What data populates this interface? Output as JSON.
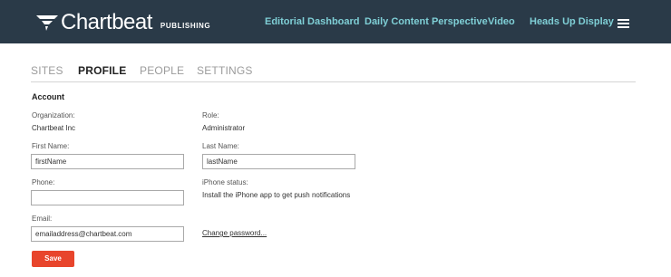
{
  "header": {
    "logo_text": "Chartbeat",
    "logo_sub": "PUBLISHING",
    "nav": [
      "Editorial Dashboard",
      "Daily Content Perspective",
      "Video",
      "Heads Up Display"
    ],
    "menu_icon": "hamburger-menu-icon"
  },
  "tabs": [
    "SITES",
    "PROFILE",
    "PEOPLE",
    "SETTINGS"
  ],
  "active_tab": "PROFILE",
  "account": {
    "title": "Account",
    "organization_label": "Organization:",
    "organization_value": "Chartbeat Inc",
    "role_label": "Role:",
    "role_value": "Administrator",
    "first_name_label": "First Name:",
    "first_name_value": "firstName",
    "last_name_label": "Last Name:",
    "last_name_value": "lastName",
    "phone_label": "Phone:",
    "phone_value": "",
    "iphone_label": "iPhone status:",
    "iphone_value": "Install the iPhone app to get push notifications",
    "email_label": "Email:",
    "email_value": "emailaddress@chartbeat.com",
    "change_password": "Change password...",
    "save": "Save"
  },
  "colors": {
    "header_bg": "#2a3a48",
    "nav_link": "#7fcfd6",
    "save_button": "#e8452c"
  }
}
